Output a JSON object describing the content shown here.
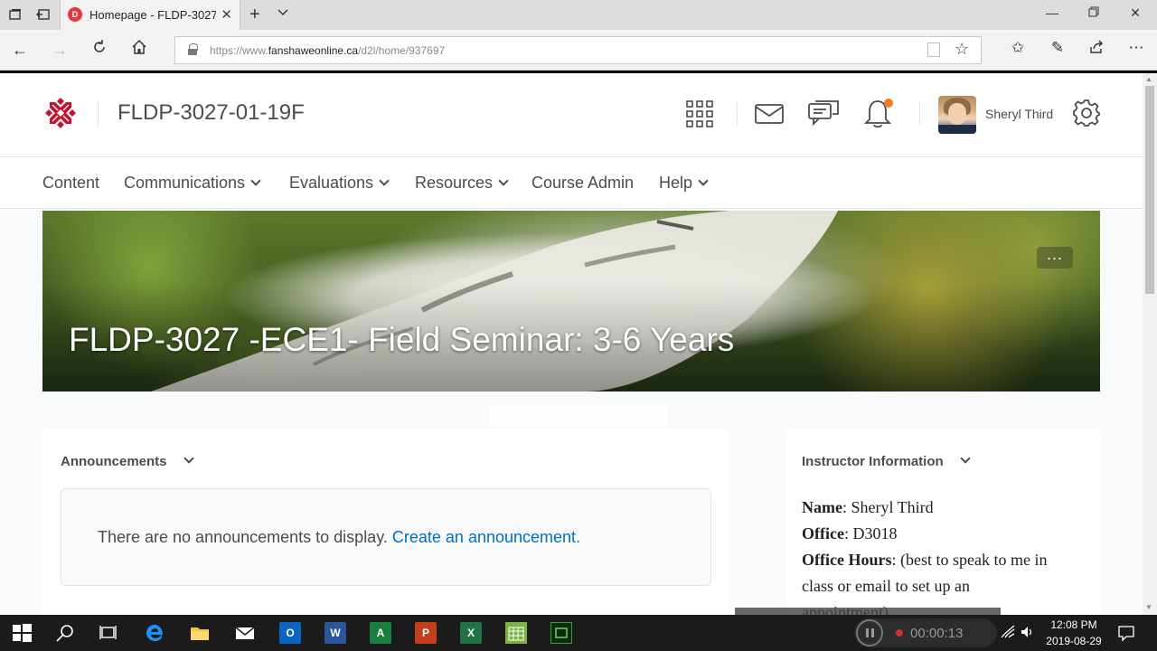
{
  "browser": {
    "tab_title": "Homepage - FLDP-3027",
    "favicon_text": "D",
    "url_prefix": "https://www.",
    "url_domain": "fanshaweonline.ca",
    "url_path": "/d2l/home/937697"
  },
  "header": {
    "course_code": "FLDP-3027-01-19F",
    "user_name": "Sheryl Third",
    "notification_color": "#f47c20"
  },
  "nav": {
    "items": [
      {
        "label": "Content"
      },
      {
        "label": "Communications"
      },
      {
        "label": "Evaluations"
      },
      {
        "label": "Resources"
      },
      {
        "label": "Course Admin"
      },
      {
        "label": "Help"
      }
    ]
  },
  "banner": {
    "title": "FLDP-3027 -ECE1- Field Seminar: 3-6 Years",
    "more_label": "..."
  },
  "announcements": {
    "title": "Announcements",
    "empty_text": "There are no announcements to display.",
    "create_link": "Create an announcement."
  },
  "instructor": {
    "title": "Instructor Information",
    "name_label": "Name",
    "name_value": ": Sheryl Third",
    "office_label": "Office",
    "office_value": ": D3018",
    "hours_label": "Office Hours",
    "hours_value": ": (best to speak to me in",
    "hours_value_2": "class or email to set up an",
    "hours_value_3": "appointment)"
  },
  "taskbar": {
    "record_time": "00:00:13",
    "clock_time": "12:08 PM",
    "clock_date": "2019-08-29"
  },
  "colors": {
    "brand_red": "#c8102e",
    "link_blue": "#006fbf",
    "text_gray": "#494c4e"
  }
}
